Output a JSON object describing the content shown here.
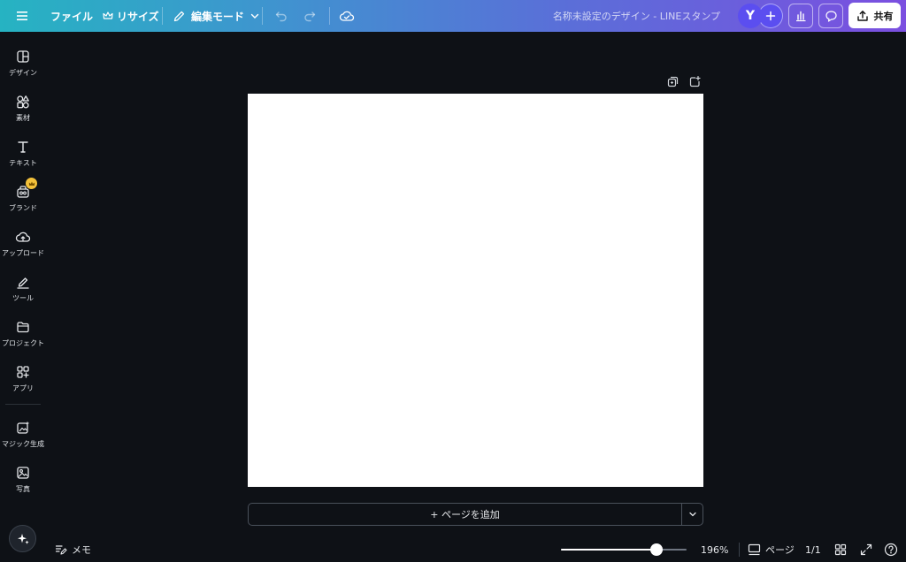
{
  "topbar": {
    "file_label": "ファイル",
    "resize_label": "リサイズ",
    "edit_mode_label": "編集モード",
    "doc_title": "名称未設定のデザイン - LINEスタンプ",
    "avatar_initial": "Y",
    "share_label": "共有"
  },
  "sidebar": {
    "items": [
      {
        "label": "デザイン",
        "icon": "design-icon"
      },
      {
        "label": "素材",
        "icon": "elements-icon"
      },
      {
        "label": "テキスト",
        "icon": "text-icon"
      },
      {
        "label": "ブランド",
        "icon": "brand-icon"
      },
      {
        "label": "アップロード",
        "icon": "upload-cloud-icon"
      },
      {
        "label": "ツール",
        "icon": "draw-icon"
      },
      {
        "label": "プロジェクト",
        "icon": "folder-icon"
      },
      {
        "label": "アプリ",
        "icon": "apps-icon"
      },
      {
        "label": "マジック生成",
        "icon": "magic-media-icon"
      },
      {
        "label": "写真",
        "icon": "photo-icon"
      }
    ]
  },
  "canvas": {
    "add_page_label": "+ ページを追加"
  },
  "bottombar": {
    "notes_label": "メモ",
    "zoom_level": 196,
    "zoom_label": "196%",
    "pages_label": "ページ",
    "page_counter": "1/1"
  },
  "colors": {
    "topbar_gradient_start": "#26b3c2",
    "topbar_gradient_end": "#7b4fe0",
    "background": "#0e1116",
    "canvas": "#ffffff",
    "avatar": "#5b4ef0",
    "crown_badge": "#f3c13a"
  }
}
